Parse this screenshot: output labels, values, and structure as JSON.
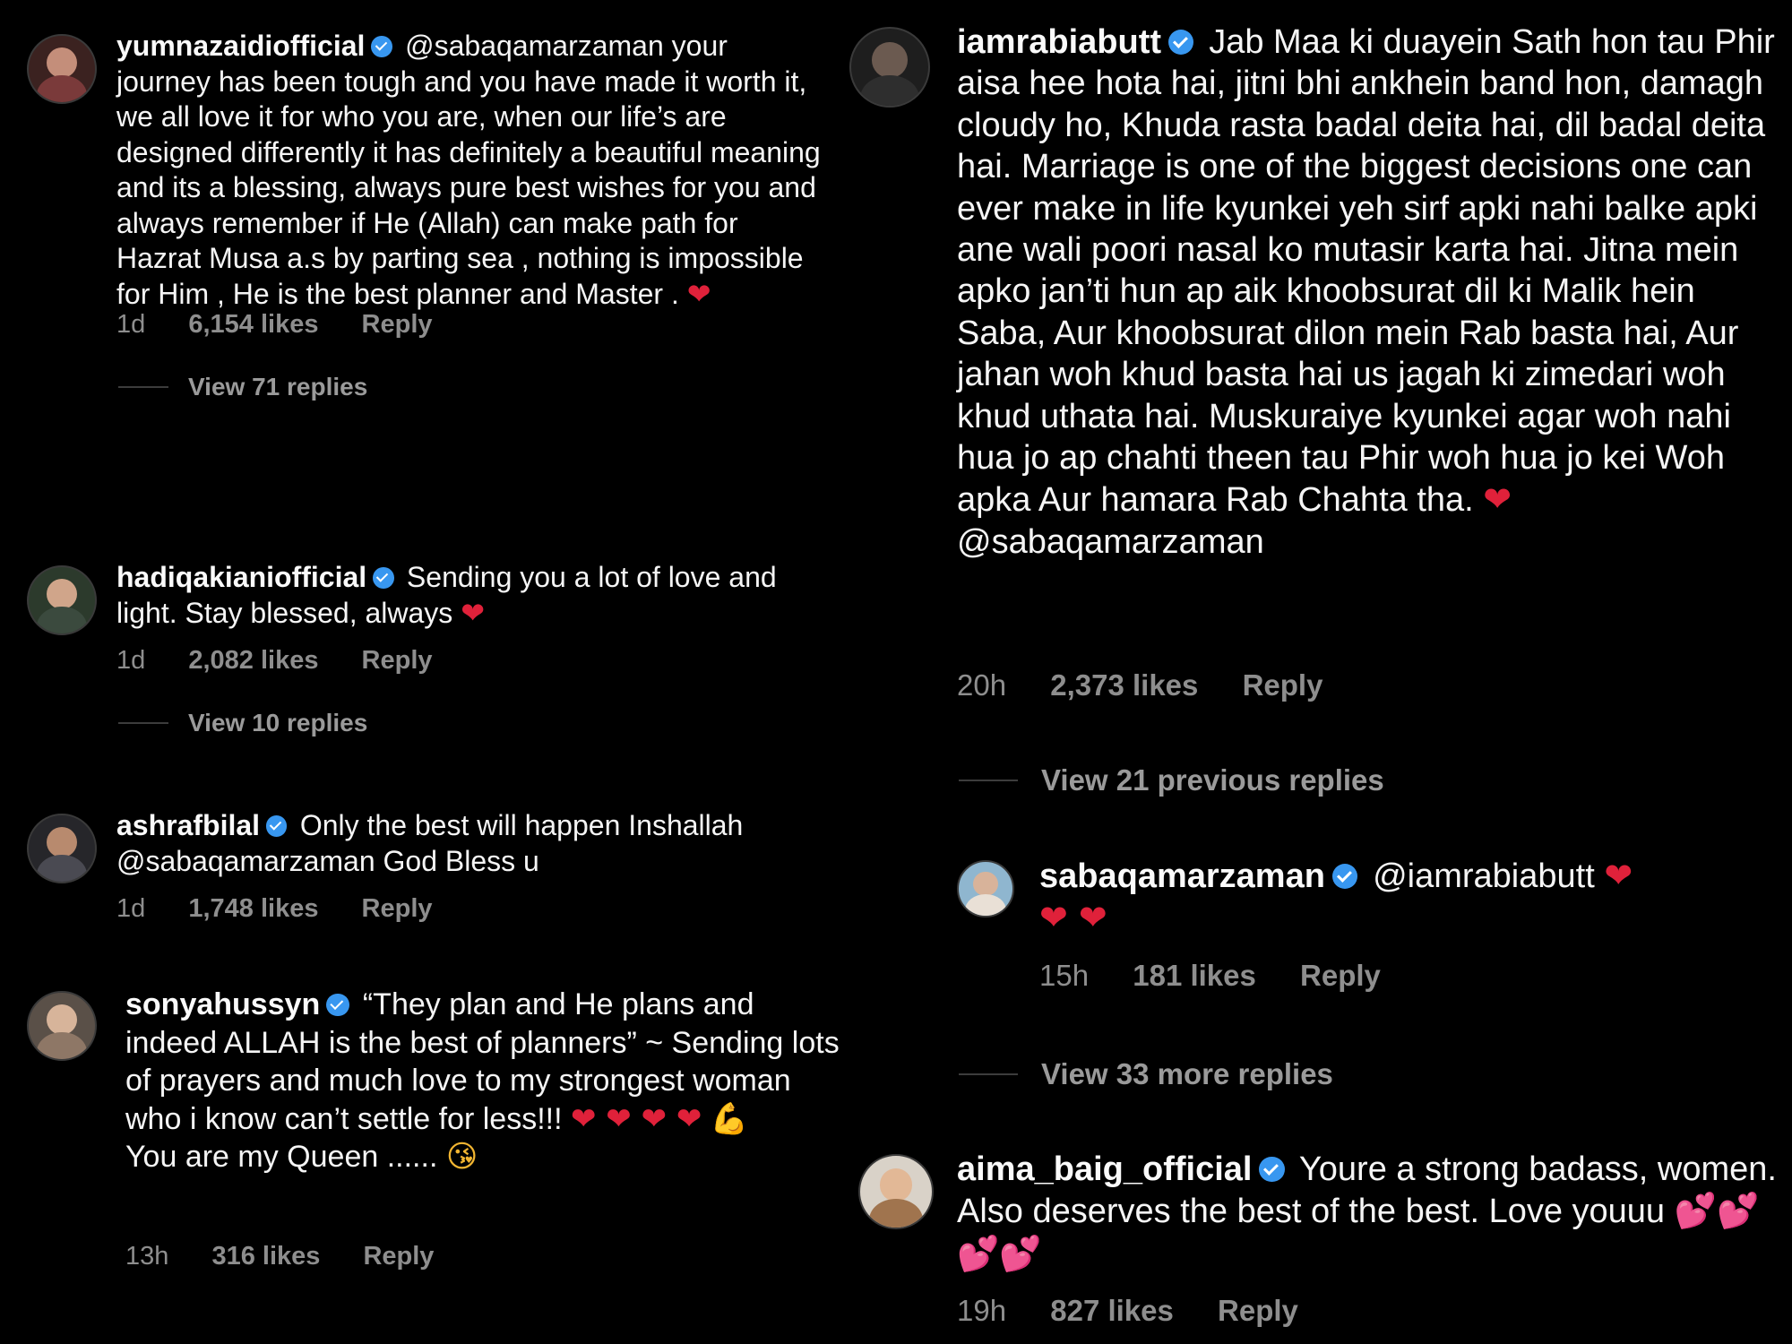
{
  "colors": {
    "background": "#000000",
    "text": "#f5f5f5",
    "meta": "#8e8e8e",
    "verified": "#3897f0",
    "heart": "#e0213a"
  },
  "icons": {
    "verified": "verified-badge-icon",
    "heart": "red-heart-emoji",
    "two_hearts": "two-hearts-emoji",
    "flexed_biceps": "flexed-biceps-emoji",
    "face_blowing_kiss": "face-blowing-kiss-emoji"
  },
  "left_column": {
    "comments": [
      {
        "username": "yumnazaidiofficial",
        "text": "@sabaqamarzaman your journey has been tough and you have made it worth it, we all love it for who you are, when our life’s are designed differently it has definitely a beautiful meaning and its a blessing, always pure best wishes for you and always remember if He (Allah) can make path for Hazrat Musa a.s  by parting sea , nothing is impossible for Him , He is the best planner and Master .",
        "time": "1d",
        "likes": "6,154 likes",
        "reply": "Reply",
        "view_replies": "View 71 replies"
      },
      {
        "username": "hadiqakianiofficial",
        "text": "Sending you a lot of love and light. Stay blessed, always",
        "time": "1d",
        "likes": "2,082 likes",
        "reply": "Reply",
        "view_replies": "View 10 replies"
      },
      {
        "username": "ashrafbilal",
        "text": "Only the best will happen Inshallah @sabaqamarzaman God Bless u",
        "time": "1d",
        "likes": "1,748 likes",
        "reply": "Reply"
      },
      {
        "username": "sonyahussyn",
        "text": "“They plan and He plans and indeed ALLAH is the best of planners” ~ Sending lots of prayers and much love to my strongest woman who i know can’t settle for less!!!",
        "text2": "You are my Queen ......",
        "time": "13h",
        "likes": "316 likes",
        "reply": "Reply"
      }
    ]
  },
  "right_column": {
    "comments": [
      {
        "username": "iamrabiabutt",
        "text": "Jab Maa ki duayein Sath hon tau Phir aisa hee hota hai, jitni bhi ankhein band hon, damagh cloudy ho, Khuda rasta badal deita hai, dil badal deita hai. Marriage is one of the biggest decisions one can ever make in life kyunkei yeh sirf apki nahi balke apki ane wali poori nasal ko mutasir karta hai. Jitna mein apko jan’ti hun ap aik khoobsurat dil ki Malik hein Saba, Aur khoobsurat dilon mein Rab basta hai, Aur jahan woh khud basta hai us jagah ki zimedari woh khud uthata hai. Muskuraiye kyunkei agar woh nahi hua jo ap chahti theen tau Phir woh hua jo kei Woh apka Aur hamara Rab Chahta tha.",
        "mention": "@sabaqamarzaman",
        "time": "20h",
        "likes": "2,373 likes",
        "reply": "Reply",
        "view_previous": "View 21 previous replies"
      },
      {
        "username": "sabaqamarzaman",
        "text": "@iamrabiabutt",
        "time": "15h",
        "likes": "181 likes",
        "reply": "Reply",
        "view_more": "View 33 more replies"
      },
      {
        "username": "aima_baig_official",
        "text": "Youre a strong badass, women. Also deserves the best of the best. Love youuu",
        "time": "19h",
        "likes": "827 likes",
        "reply": "Reply"
      }
    ]
  }
}
